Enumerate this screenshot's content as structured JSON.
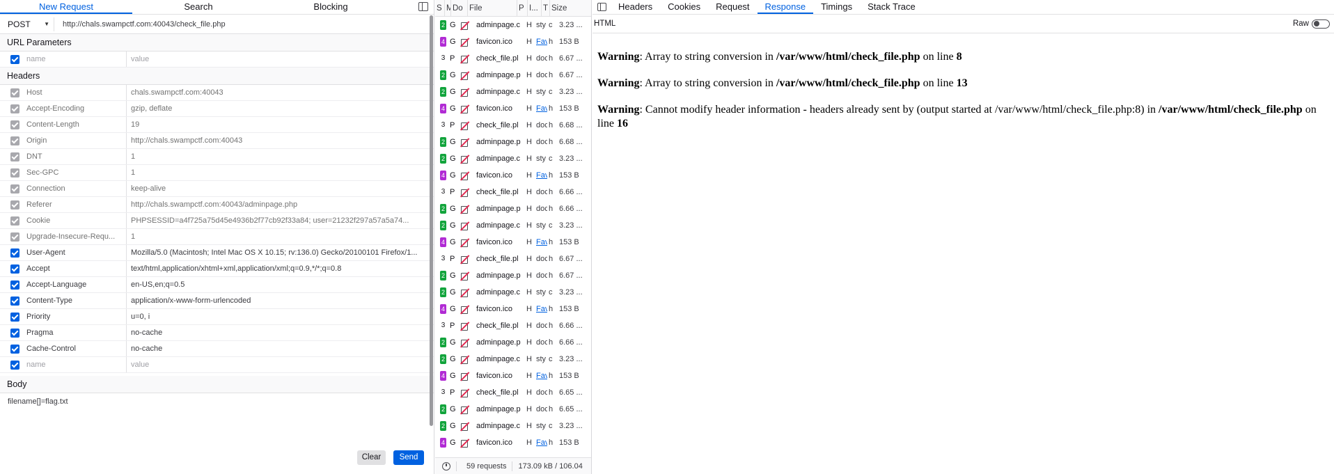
{
  "left": {
    "tabs": [
      "New Request",
      "Search",
      "Blocking"
    ],
    "method": "POST",
    "url": "http://chals.swampctf.com:40043/check_file.php",
    "url_params_title": "URL Parameters",
    "param_placeholder_name": "name",
    "param_placeholder_value": "value",
    "headers_title": "Headers",
    "headers": [
      {
        "name": "Host",
        "value": "chals.swampctf.com:40043",
        "on": false
      },
      {
        "name": "Accept-Encoding",
        "value": "gzip, deflate",
        "on": false
      },
      {
        "name": "Content-Length",
        "value": "19",
        "on": false
      },
      {
        "name": "Origin",
        "value": "http://chals.swampctf.com:40043",
        "on": false
      },
      {
        "name": "DNT",
        "value": "1",
        "on": false
      },
      {
        "name": "Sec-GPC",
        "value": "1",
        "on": false
      },
      {
        "name": "Connection",
        "value": "keep-alive",
        "on": false
      },
      {
        "name": "Referer",
        "value": "http://chals.swampctf.com:40043/adminpage.php",
        "on": false
      },
      {
        "name": "Cookie",
        "value": "PHPSESSID=a4f725a75d45e4936b2f77cb92f33a84; user=21232f297a57a5a74...",
        "on": false
      },
      {
        "name": "Upgrade-Insecure-Requ...",
        "value": "1",
        "on": false
      },
      {
        "name": "User-Agent",
        "value": "Mozilla/5.0 (Macintosh; Intel Mac OS X 10.15; rv:136.0) Gecko/20100101 Firefox/1...",
        "on": true
      },
      {
        "name": "Accept",
        "value": "text/html,application/xhtml+xml,application/xml;q=0.9,*/*;q=0.8",
        "on": true
      },
      {
        "name": "Accept-Language",
        "value": "en-US,en;q=0.5",
        "on": true
      },
      {
        "name": "Content-Type",
        "value": "application/x-www-form-urlencoded",
        "on": true
      },
      {
        "name": "Priority",
        "value": "u=0, i",
        "on": true
      },
      {
        "name": "Pragma",
        "value": "no-cache",
        "on": true
      },
      {
        "name": "Cache-Control",
        "value": "no-cache",
        "on": true
      }
    ],
    "body_title": "Body",
    "body_value": "filename[]=flag.txt",
    "clear_label": "Clear",
    "send_label": "Send"
  },
  "requests": {
    "columns": [
      "S",
      "M",
      "Do",
      "File",
      "P",
      "I...",
      "T",
      "Size"
    ],
    "rows": [
      {
        "s": "2",
        "sc": "s2",
        "m": "G",
        "file": "adminpage.c",
        "p": "H",
        "init": "sty",
        "link": false,
        "t": "c",
        "size": "3.23 ..."
      },
      {
        "s": "4",
        "sc": "s4",
        "m": "G",
        "file": "favicon.ico",
        "p": "H",
        "init": "Fav",
        "link": true,
        "t": "h",
        "size": "153 B"
      },
      {
        "s": "3",
        "sc": "s3",
        "m": "P",
        "file": "check_file.pl",
        "p": "H",
        "init": "doc",
        "link": false,
        "t": "h",
        "size": "6.67 ..."
      },
      {
        "s": "2",
        "sc": "s2",
        "m": "G",
        "file": "adminpage.p",
        "p": "H",
        "init": "doc",
        "link": false,
        "t": "h",
        "size": "6.67 ..."
      },
      {
        "s": "2",
        "sc": "s2",
        "m": "G",
        "file": "adminpage.c",
        "p": "H",
        "init": "sty",
        "link": false,
        "t": "c",
        "size": "3.23 ..."
      },
      {
        "s": "4",
        "sc": "s4",
        "m": "G",
        "file": "favicon.ico",
        "p": "H",
        "init": "Fav",
        "link": true,
        "t": "h",
        "size": "153 B"
      },
      {
        "s": "3",
        "sc": "s3",
        "m": "P",
        "file": "check_file.pl",
        "p": "H",
        "init": "doc",
        "link": false,
        "t": "h",
        "size": "6.68 ..."
      },
      {
        "s": "2",
        "sc": "s2",
        "m": "G",
        "file": "adminpage.p",
        "p": "H",
        "init": "doc",
        "link": false,
        "t": "h",
        "size": "6.68 ..."
      },
      {
        "s": "2",
        "sc": "s2",
        "m": "G",
        "file": "adminpage.c",
        "p": "H",
        "init": "sty",
        "link": false,
        "t": "c",
        "size": "3.23 ..."
      },
      {
        "s": "4",
        "sc": "s4",
        "m": "G",
        "file": "favicon.ico",
        "p": "H",
        "init": "Fav",
        "link": true,
        "t": "h",
        "size": "153 B"
      },
      {
        "s": "3",
        "sc": "s3",
        "m": "P",
        "file": "check_file.pl",
        "p": "H",
        "init": "doc",
        "link": false,
        "t": "h",
        "size": "6.66 ..."
      },
      {
        "s": "2",
        "sc": "s2",
        "m": "G",
        "file": "adminpage.p",
        "p": "H",
        "init": "doc",
        "link": false,
        "t": "h",
        "size": "6.66 ..."
      },
      {
        "s": "2",
        "sc": "s2",
        "m": "G",
        "file": "adminpage.c",
        "p": "H",
        "init": "sty",
        "link": false,
        "t": "c",
        "size": "3.23 ..."
      },
      {
        "s": "4",
        "sc": "s4",
        "m": "G",
        "file": "favicon.ico",
        "p": "H",
        "init": "Fav",
        "link": true,
        "t": "h",
        "size": "153 B"
      },
      {
        "s": "3",
        "sc": "s3",
        "m": "P",
        "file": "check_file.pl",
        "p": "H",
        "init": "doc",
        "link": false,
        "t": "h",
        "size": "6.67 ..."
      },
      {
        "s": "2",
        "sc": "s2",
        "m": "G",
        "file": "adminpage.p",
        "p": "H",
        "init": "doc",
        "link": false,
        "t": "h",
        "size": "6.67 ..."
      },
      {
        "s": "2",
        "sc": "s2",
        "m": "G",
        "file": "adminpage.c",
        "p": "H",
        "init": "sty",
        "link": false,
        "t": "c",
        "size": "3.23 ..."
      },
      {
        "s": "4",
        "sc": "s4",
        "m": "G",
        "file": "favicon.ico",
        "p": "H",
        "init": "Fav",
        "link": true,
        "t": "h",
        "size": "153 B"
      },
      {
        "s": "3",
        "sc": "s3",
        "m": "P",
        "file": "check_file.pl",
        "p": "H",
        "init": "doc",
        "link": false,
        "t": "h",
        "size": "6.66 ..."
      },
      {
        "s": "2",
        "sc": "s2",
        "m": "G",
        "file": "adminpage.p",
        "p": "H",
        "init": "doc",
        "link": false,
        "t": "h",
        "size": "6.66 ..."
      },
      {
        "s": "2",
        "sc": "s2",
        "m": "G",
        "file": "adminpage.c",
        "p": "H",
        "init": "sty",
        "link": false,
        "t": "c",
        "size": "3.23 ..."
      },
      {
        "s": "4",
        "sc": "s4",
        "m": "G",
        "file": "favicon.ico",
        "p": "H",
        "init": "Fav",
        "link": true,
        "t": "h",
        "size": "153 B"
      },
      {
        "s": "3",
        "sc": "s3",
        "m": "P",
        "file": "check_file.pl",
        "p": "H",
        "init": "doc",
        "link": false,
        "t": "h",
        "size": "6.65 ..."
      },
      {
        "s": "2",
        "sc": "s2",
        "m": "G",
        "file": "adminpage.p",
        "p": "H",
        "init": "doc",
        "link": false,
        "t": "h",
        "size": "6.65 ..."
      },
      {
        "s": "2",
        "sc": "s2",
        "m": "G",
        "file": "adminpage.c",
        "p": "H",
        "init": "sty",
        "link": false,
        "t": "c",
        "size": "3.23 ..."
      },
      {
        "s": "4",
        "sc": "s4",
        "m": "G",
        "file": "favicon.ico",
        "p": "H",
        "init": "Fav",
        "link": true,
        "t": "h",
        "size": "153 B"
      }
    ],
    "footer_count": "59 requests",
    "footer_size": "173.09 kB / 106.04"
  },
  "right": {
    "tabs": [
      "Headers",
      "Cookies",
      "Request",
      "Response",
      "Timings",
      "Stack Trace"
    ],
    "active_tab": "Response",
    "format_label": "HTML",
    "raw_label": "Raw",
    "warnings": [
      {
        "label": "Warning",
        "text": ": Array to string conversion in ",
        "path": "/var/www/html/check_file.php",
        "mid": " on line ",
        "line": "8"
      },
      {
        "label": "Warning",
        "text": ": Array to string conversion in ",
        "path": "/var/www/html/check_file.php",
        "mid": " on line ",
        "line": "13"
      },
      {
        "label": "Warning",
        "text": ": Cannot modify header information - headers already sent by (output started at /var/www/html/check_file.php:8) in ",
        "path": "/var/www/html/check_file.php",
        "mid": " on line ",
        "line": "16"
      }
    ]
  }
}
